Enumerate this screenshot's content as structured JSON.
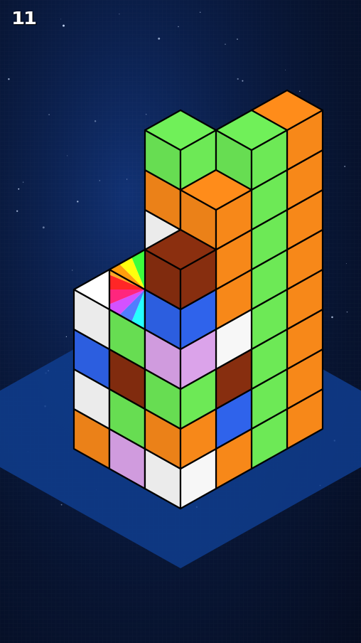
{
  "hud": {
    "score": "11"
  },
  "colors": {
    "green": "#70f059",
    "orange": "#ff8c1a",
    "brown": "#8b2f0f",
    "blue": "#3066f2",
    "white": "#ffffff",
    "pink": "#e2a8f1",
    "red": "#ff1111",
    "floor": "#0f3d8e"
  },
  "grid": {
    "size": [
      4,
      4
    ],
    "columns": [
      {
        "pos": [
          0,
          0
        ],
        "stack": [
          "white",
          "orange",
          "green",
          "pink",
          "blue",
          "brown"
        ]
      },
      {
        "pos": [
          1,
          0
        ],
        "stack": [
          "pink",
          "green",
          "brown",
          "green"
        ]
      },
      {
        "pos": [
          2,
          0
        ],
        "stack": [
          "orange",
          "white",
          "blue",
          "white"
        ]
      },
      {
        "pos": [
          0,
          1
        ],
        "stack": [
          "orange",
          "blue",
          "brown",
          "white",
          "orange",
          "orange",
          "orange"
        ]
      },
      {
        "pos": [
          0,
          2
        ],
        "stack": [
          "green",
          "green",
          "green",
          "green",
          "green",
          "green",
          "green",
          "green"
        ]
      },
      {
        "pos": [
          1,
          3
        ],
        "stack": [
          "white",
          "blue",
          "brown",
          "brown",
          "orange",
          "orange"
        ]
      },
      {
        "pos": [
          0,
          3
        ],
        "stack": [
          "orange",
          "orange",
          "orange",
          "orange",
          "orange",
          "orange",
          "orange",
          "orange"
        ]
      },
      {
        "pos": [
          2,
          3
        ],
        "stack": [
          "white",
          "blue",
          "brown",
          "brown",
          "brown"
        ]
      },
      {
        "pos": [
          3,
          3
        ],
        "stack": [
          "red",
          "white",
          "blue",
          "white",
          "orange",
          "green"
        ]
      }
    ],
    "special_cube": {
      "pos": [
        1,
        0
      ],
      "level": 4,
      "type": "rainbow"
    }
  }
}
